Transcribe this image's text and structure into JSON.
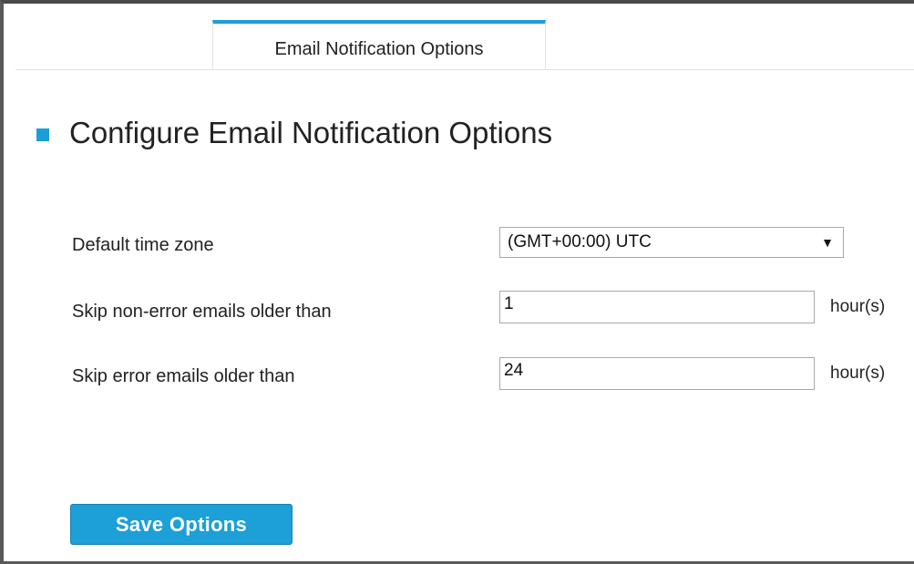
{
  "tabs": [
    {
      "label": "Email Notification Options",
      "active": true
    }
  ],
  "section": {
    "title": "Configure Email Notification Options"
  },
  "form": {
    "time_zone": {
      "label": "Default time zone",
      "value": "(GMT+00:00) UTC"
    },
    "skip_non_error": {
      "label": "Skip non-error emails older than",
      "value": "1",
      "unit": "hour(s)"
    },
    "skip_error": {
      "label": "Skip error emails older than",
      "value": "24",
      "unit": "hour(s)"
    }
  },
  "actions": {
    "save_label": "Save Options"
  },
  "colors": {
    "accent": "#1b9ed6",
    "button": "#1d9fd8",
    "text": "#222222"
  }
}
